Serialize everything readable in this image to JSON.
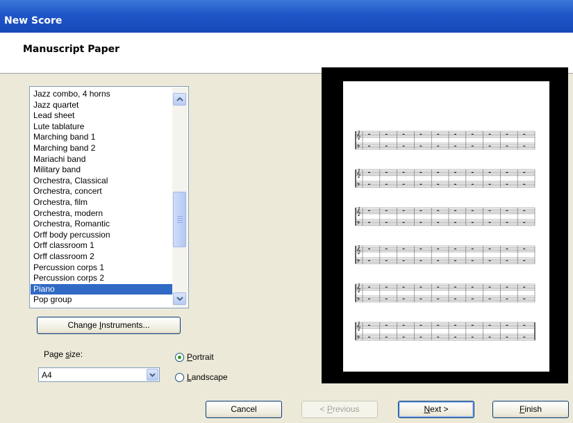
{
  "window": {
    "title": "New Score"
  },
  "header": {
    "title": "Manuscript Paper"
  },
  "manuscript_list": {
    "items": [
      "Jazz combo, 4 horns",
      "Jazz quartet",
      "Lead sheet",
      "Lute tablature",
      "Marching band 1",
      "Marching band 2",
      "Mariachi band",
      "Military band",
      "Orchestra, Classical",
      "Orchestra, concert",
      "Orchestra, film",
      "Orchestra, modern",
      "Orchestra, Romantic",
      "Orff body percussion",
      "Orff classroom 1",
      "Orff classroom 2",
      "Percussion corps 1",
      "Percussion corps 2",
      "Piano",
      "Pop group"
    ],
    "selected": "Piano"
  },
  "change_instruments": {
    "pre": "Change ",
    "accel": "I",
    "post": "nstruments..."
  },
  "page_size": {
    "label_pre": "Page ",
    "label_accel": "s",
    "label_post": "ize:",
    "value": "A4"
  },
  "orientation": {
    "portrait": {
      "accel": "P",
      "rest": "ortrait",
      "checked": true
    },
    "landscape": {
      "accel": "L",
      "rest": "andscape",
      "checked": false
    }
  },
  "buttons": {
    "cancel": "Cancel",
    "previous": {
      "pre": "< ",
      "accel": "P",
      "post": "revious"
    },
    "next": {
      "accel": "N",
      "post": "ext >"
    },
    "finish": {
      "accel": "F",
      "post": "inish"
    }
  },
  "preview": {
    "systems": 6,
    "measures_per_system": 10
  },
  "colors": {
    "selection": "#316ac5",
    "titlebar": "#1f56c8",
    "radio_dot": "#21a121"
  }
}
